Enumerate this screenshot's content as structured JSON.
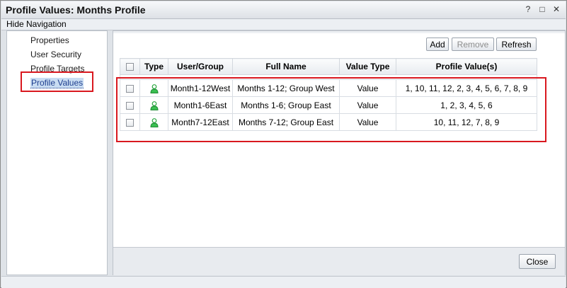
{
  "window": {
    "title": "Profile Values: Months Profile",
    "help_glyph": "?",
    "restore_glyph": "□",
    "close_glyph": "✕"
  },
  "nav_toggle": {
    "label": "Hide Navigation"
  },
  "sidebar": {
    "items": [
      {
        "label": "Properties"
      },
      {
        "label": "User Security"
      },
      {
        "label": "Profile Targets"
      },
      {
        "label": "Profile Values",
        "selected": true
      }
    ]
  },
  "toolbar": {
    "add_label": "Add",
    "remove_label": "Remove",
    "remove_enabled": false,
    "refresh_label": "Refresh"
  },
  "table": {
    "columns": [
      "",
      "Type",
      "User/Group",
      "Full Name",
      "Value Type",
      "Profile Value(s)"
    ],
    "rows": [
      {
        "type_icon": "user-icon",
        "user_group": "Month1-12West",
        "full_name": "Months 1-12; Group West",
        "value_type": "Value",
        "profile_values": "1, 10, 11, 12, 2, 3, 4, 5, 6, 7, 8, 9"
      },
      {
        "type_icon": "user-icon",
        "user_group": "Month1-6East",
        "full_name": "Months 1-6; Group East",
        "value_type": "Value",
        "profile_values": "1, 2, 3, 4, 5, 6"
      },
      {
        "type_icon": "user-icon",
        "user_group": "Month7-12East",
        "full_name": "Months 7-12; Group East",
        "value_type": "Value",
        "profile_values": "10, 11, 12, 7, 8, 9"
      }
    ]
  },
  "footer": {
    "close_label": "Close"
  },
  "colors": {
    "highlight": "#d9181f",
    "selected_nav_bg": "#c8dcf2",
    "user_icon": "#2aa640"
  }
}
